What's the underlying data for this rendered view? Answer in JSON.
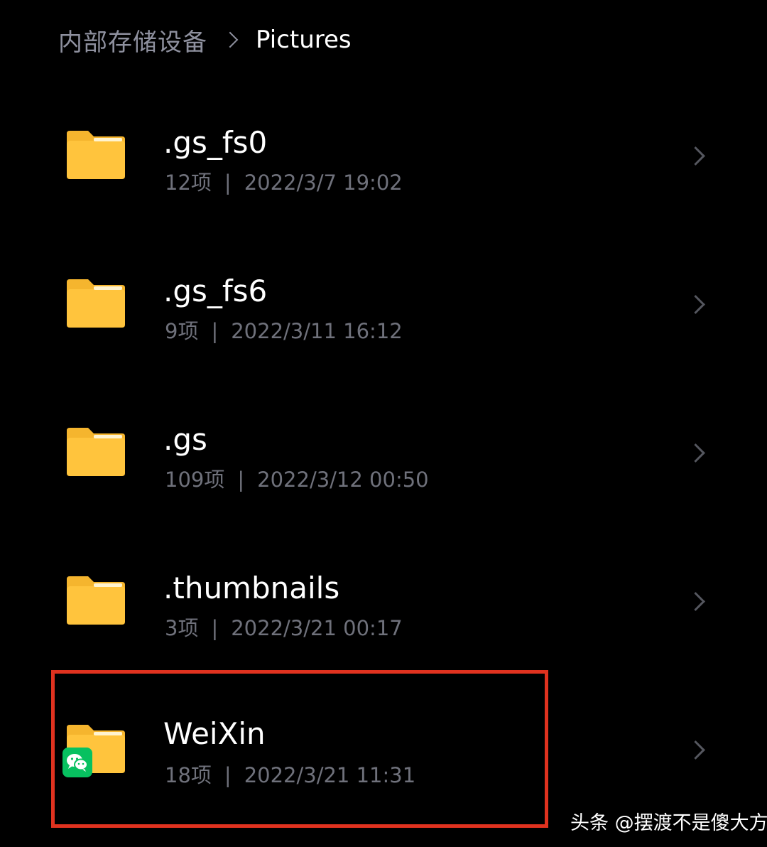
{
  "breadcrumb": {
    "root": "内部存储设备",
    "current": "Pictures"
  },
  "folders": [
    {
      "name": ".gs_fs0",
      "count": "12项",
      "modified": "2022/3/7 19:02"
    },
    {
      "name": ".gs_fs6",
      "count": "9项",
      "modified": "2022/3/11 16:12"
    },
    {
      "name": ".gs",
      "count": "109项",
      "modified": "2022/3/12 00:50"
    },
    {
      "name": ".thumbnails",
      "count": "3项",
      "modified": "2022/3/21 00:17"
    },
    {
      "name": "WeiXin",
      "count": "18项",
      "modified": "2022/3/21 11:31",
      "badge_icon": "wechat-icon"
    }
  ],
  "meta_separator": "|",
  "watermark": "头条 @摆渡不是傻大方",
  "colors": {
    "background": "#000000",
    "folder": "#ffc43d",
    "folder_tab": "#f5b52e",
    "highlight": "#e0321f",
    "wechat": "#07c160",
    "muted_text": "#6f717b"
  },
  "icons": {
    "folder": "folder-icon",
    "chevron": "chevron-right-icon",
    "separator": "chevron-right-icon"
  }
}
